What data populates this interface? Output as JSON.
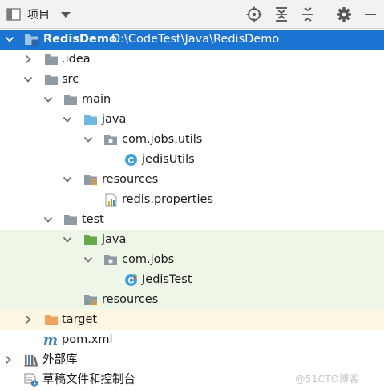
{
  "toolbar": {
    "view_label": "项目",
    "icons": [
      "project-view-icon",
      "dropdown-caret-icon",
      "locate-file-icon",
      "expand-all-icon",
      "collapse-all-icon",
      "settings-gear-icon",
      "hide-minus-icon"
    ]
  },
  "tree": {
    "root": {
      "name": "RedisDemo",
      "path": "D:\\CodeTest\\Java\\RedisDemo"
    },
    "idea": ".idea",
    "src": "src",
    "main": "main",
    "main_java": "java",
    "main_pkg": "com.jobs.utils",
    "main_class": "jedisUtils",
    "main_resources": "resources",
    "properties_file": "redis.properties",
    "test": "test",
    "test_java": "java",
    "test_pkg": "com.jobs",
    "test_class": "JedisTest",
    "test_resources": "resources",
    "target": "target",
    "pom": "pom.xml",
    "external_libs": "外部库",
    "scratches": "草稿文件和控制台"
  },
  "colors": {
    "selection": "#1c74d2",
    "test_background": "#eef6e8",
    "source_folder": "#6fb8e0",
    "test_folder": "#6aa84f",
    "excluded_folder": "#f0a35e",
    "folder_grey": "#8f9aa3"
  },
  "watermark": "@51CTO博客"
}
